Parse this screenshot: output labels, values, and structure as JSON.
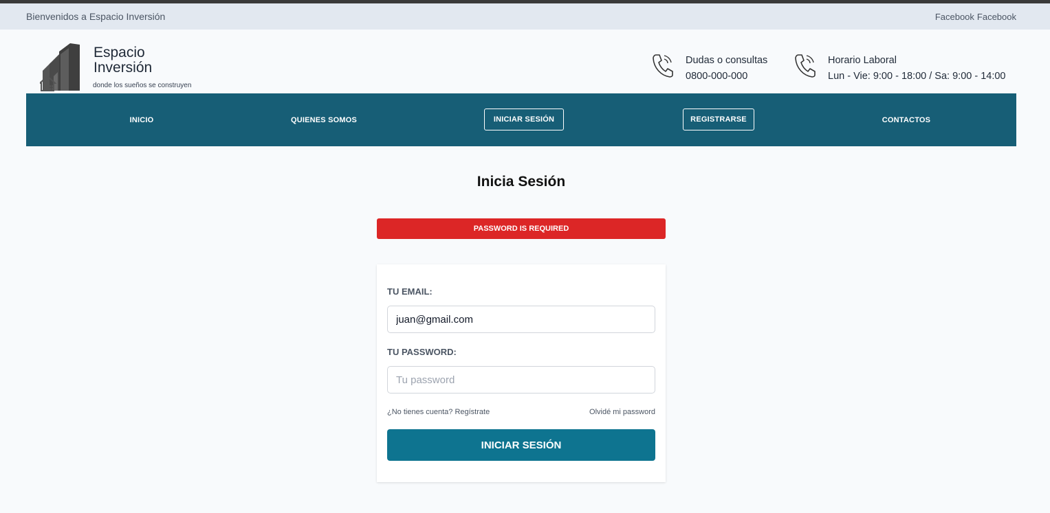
{
  "topbar": {
    "welcome": "Bienvenidos a Espacio Inversión",
    "social": [
      "Facebook",
      "Facebook"
    ]
  },
  "logo": {
    "line1": "Espacio",
    "line2": "Inversión",
    "tagline": "donde los sueños se construyen"
  },
  "contact": {
    "consultas_title": "Dudas o consultas",
    "consultas_phone": "0800-000-000",
    "horario_title": "Horario Laboral",
    "horario_value": "Lun - Vie: 9:00 - 18:00 / Sa: 9:00 - 14:00"
  },
  "nav": {
    "items": [
      "INICIO",
      "QUIENES SOMOS",
      "INICIAR SESIÓN",
      "REGISTRARSE",
      "CONTACTOS"
    ]
  },
  "page": {
    "title": "Inicia Sesión"
  },
  "alert": {
    "message": "PASSWORD IS REQUIRED"
  },
  "form": {
    "email_label": "TU EMAIL:",
    "email_value": "juan@gmail.com",
    "password_label": "TU PASSWORD:",
    "password_placeholder": "Tu password",
    "register_link": "¿No tienes cuenta? Regístrate",
    "forgot_link": "Olvidé mi password",
    "submit_label": "INICIAR SESIÓN"
  },
  "colors": {
    "nav_bg": "#175e76",
    "alert_bg": "#dc2626",
    "button_bg": "#0e7490",
    "topbar_bg": "#e2e8f0"
  },
  "icons": [
    "building-logo-icon",
    "phone-icon",
    "phone-icon"
  ]
}
